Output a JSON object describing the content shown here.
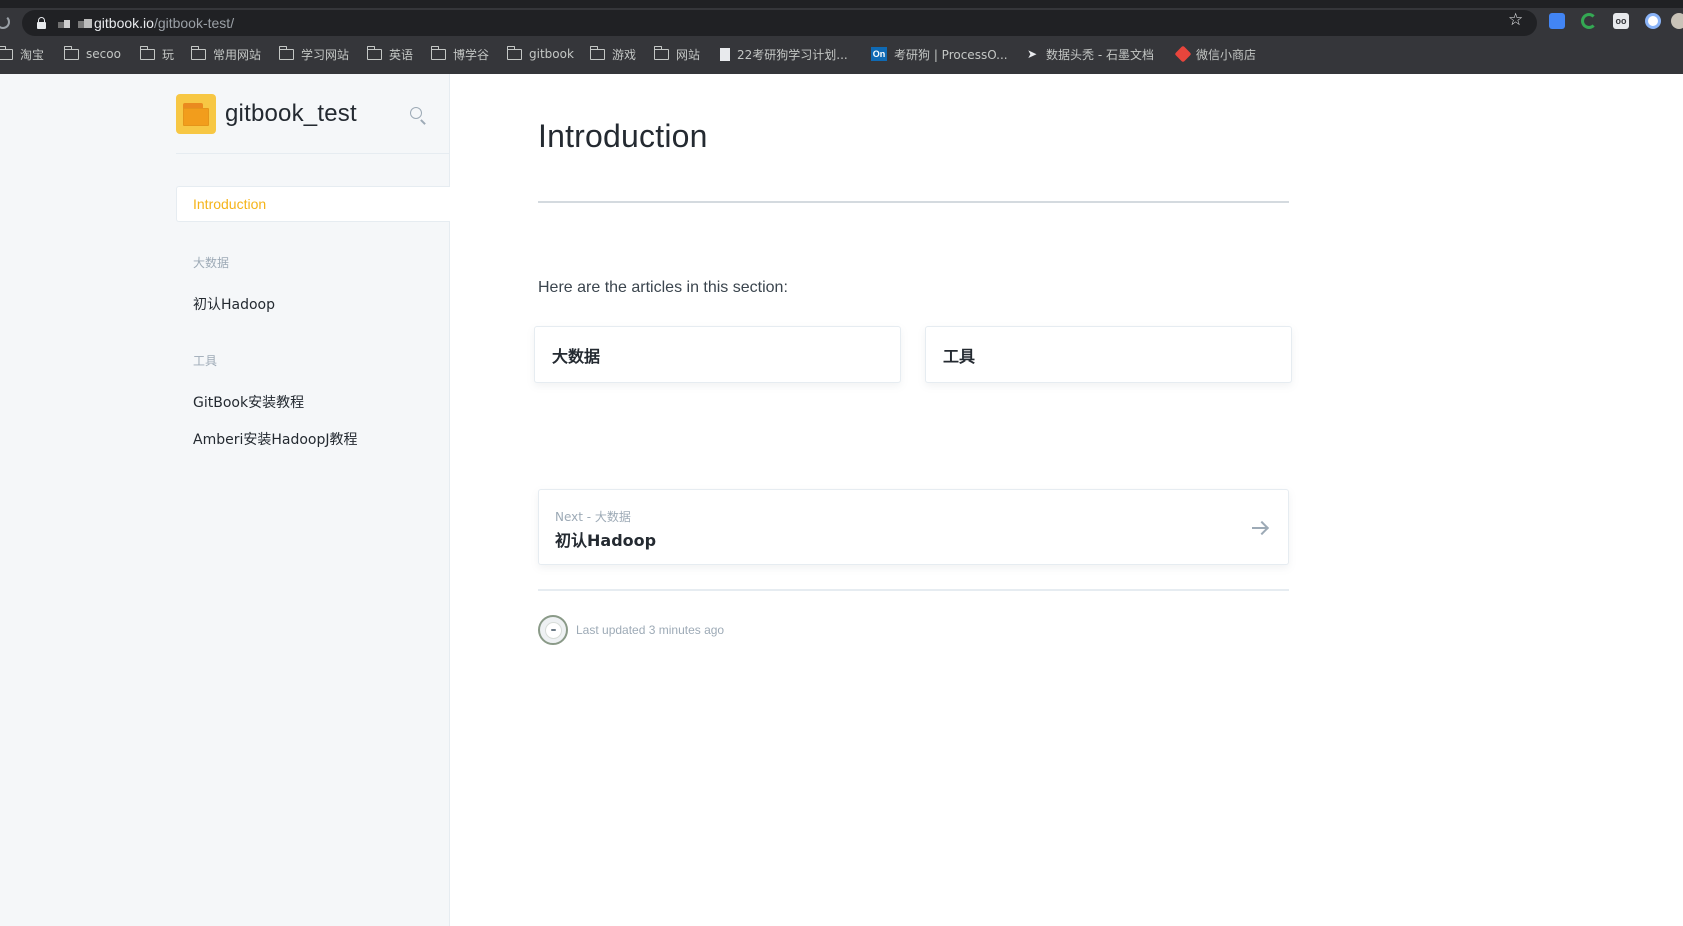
{
  "browser": {
    "url_host": "gitbook.io",
    "url_path": "/gitbook-test/",
    "bookmarks": [
      {
        "label": "淘宝",
        "icon": "folder-icon"
      },
      {
        "label": "secoo",
        "icon": "folder-icon"
      },
      {
        "label": "玩",
        "icon": "folder-icon"
      },
      {
        "label": "常用网站",
        "icon": "folder-icon"
      },
      {
        "label": "学习网站",
        "icon": "folder-icon"
      },
      {
        "label": "英语",
        "icon": "folder-icon"
      },
      {
        "label": "博学谷",
        "icon": "folder-icon"
      },
      {
        "label": "gitbook",
        "icon": "folder-icon"
      },
      {
        "label": "游戏",
        "icon": "folder-icon"
      },
      {
        "label": "网站",
        "icon": "folder-icon"
      },
      {
        "label": "22考研狗学习计划...",
        "icon": "document-icon"
      },
      {
        "label": "考研狗 | ProcessO...",
        "icon": "processon-icon",
        "badge": "On"
      },
      {
        "label": "数据头秃 - 石墨文档",
        "icon": "shimo-icon"
      },
      {
        "label": "微信小商店",
        "icon": "wechat-store-icon"
      }
    ]
  },
  "sidebar": {
    "title": "gitbook_test",
    "active_item": "Introduction",
    "groups": [
      {
        "heading": "大数据",
        "items": [
          "初认Hadoop"
        ]
      },
      {
        "heading": "工具",
        "items": [
          "GitBook安装教程",
          "Amberi安装HadoopJ教程"
        ]
      }
    ]
  },
  "main": {
    "title": "Introduction",
    "intro": "Here are the articles in this section:",
    "cards": [
      "大数据",
      "工具"
    ],
    "next": {
      "label": "Next - 大数据",
      "title": "初认Hadoop"
    },
    "last_updated": "Last updated 3 minutes ago"
  },
  "colors": {
    "accent": "#f5b41a",
    "sidebar_bg": "#f5f7f9",
    "text": "#242a31",
    "muted": "#9daab6"
  }
}
